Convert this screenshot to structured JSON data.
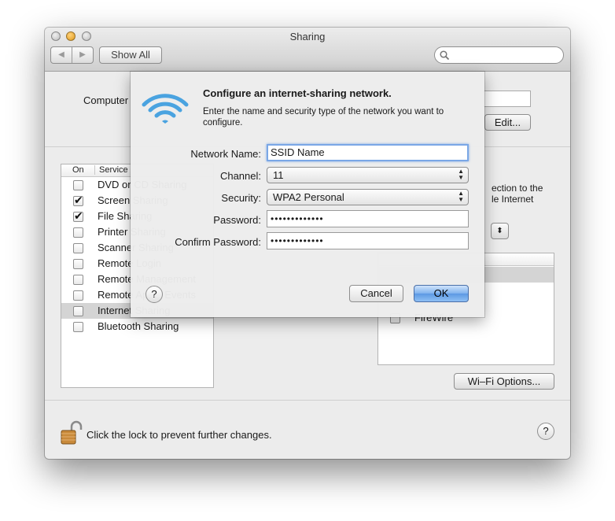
{
  "window": {
    "title": "Sharing",
    "nav_back": "◀",
    "nav_forward": "▶",
    "show_all": "Show All",
    "search_placeholder": ""
  },
  "computer": {
    "label": "Computer",
    "edit_button": "Edit..."
  },
  "services": {
    "header_on": "On",
    "header_service": "Service",
    "items": [
      {
        "label": "DVD or CD Sharing",
        "checked": false
      },
      {
        "label": "Screen Sharing",
        "checked": true
      },
      {
        "label": "File Sharing",
        "checked": true
      },
      {
        "label": "Printer Sharing",
        "checked": false
      },
      {
        "label": "Scanner Sharing",
        "checked": false
      },
      {
        "label": "Remote Login",
        "checked": false
      },
      {
        "label": "Remote Management",
        "checked": false
      },
      {
        "label": "Remote Apple Events",
        "checked": false
      },
      {
        "label": "Internet Sharing",
        "checked": false,
        "selected": true
      },
      {
        "label": "Bluetooth Sharing",
        "checked": false
      }
    ]
  },
  "internet_sharing": {
    "description_line1": "ection to the",
    "description_line2": "le Internet",
    "ports": [
      {
        "label": "FireWire",
        "checked": false
      }
    ],
    "wifi_options_button": "Wi–Fi Options..."
  },
  "footer": {
    "lock_text": "Click the lock to prevent further changes.",
    "help": "?"
  },
  "sheet": {
    "title": "Configure an internet-sharing network.",
    "description": "Enter the name and security type of the network you want to configure.",
    "network_name_label": "Network Name:",
    "network_name_value": "SSID Name",
    "channel_label": "Channel:",
    "channel_value": "11",
    "security_label": "Security:",
    "security_value": "WPA2 Personal",
    "password_label": "Password:",
    "password_value": "•••••••••••••",
    "confirm_label": "Confirm Password:",
    "confirm_value": "•••••••••••••",
    "help": "?",
    "cancel": "Cancel",
    "ok": "OK"
  },
  "colors": {
    "window_bg": "#ececec",
    "ok_accent": "#6aa6ec",
    "wifi_icon": "#4aa3e0",
    "lock": "#c98a3a"
  }
}
